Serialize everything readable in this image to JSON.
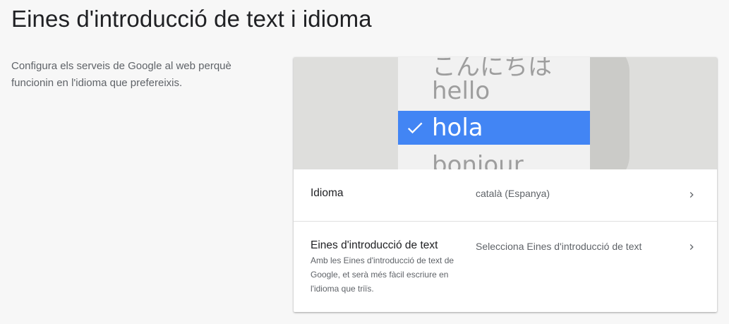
{
  "header": {
    "title": "Eines d'introducció de text i idioma"
  },
  "intro": {
    "text": "Configura els serveis de Google al web perquè funcionin en l'idioma que prefereixis."
  },
  "illustration": {
    "words": {
      "japanese": "こんにちは",
      "english": "hello",
      "selected": "hola",
      "french": "bonjour"
    },
    "selected_color": "#4285f4",
    "icon": "check-icon"
  },
  "settings": {
    "language": {
      "label": "Idioma",
      "value": "català (Espanya)",
      "icon": "chevron-right-icon"
    },
    "input_tools": {
      "label": "Eines d'introducció de text",
      "description": "Amb les Eines d'introducció de text de Google, et serà més fàcil escriure en l'idioma que triïs.",
      "value": "Selecciona Eines d'introducció de text",
      "icon": "chevron-right-icon"
    }
  }
}
